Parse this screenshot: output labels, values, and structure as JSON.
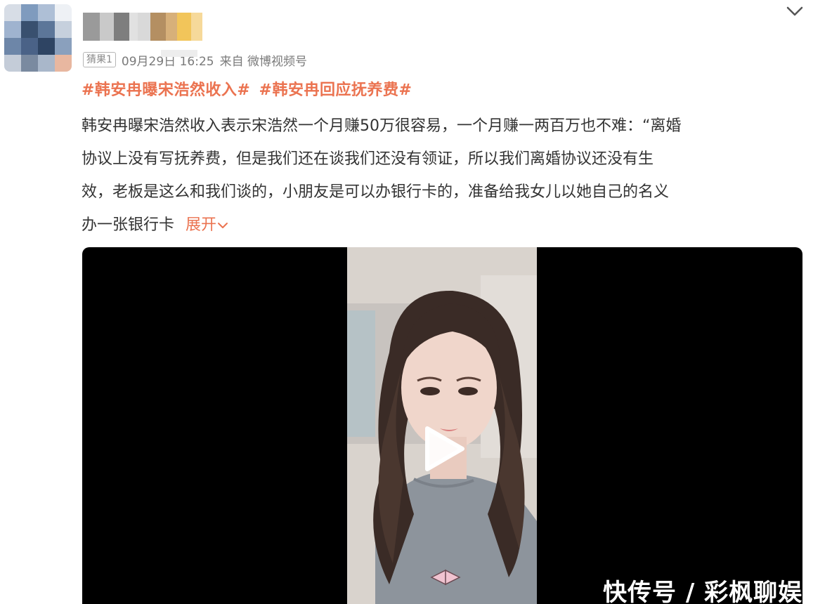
{
  "header": {
    "badge": "猜果1",
    "timestamp": "09月29日 16:25",
    "source": "来自 微博视频号",
    "menu_icon": "chevron-down-icon"
  },
  "post": {
    "tags": [
      "#韩安冉曝宋浩然收入#",
      "#韩安冉回应抚养费#"
    ],
    "lines": [
      "韩安冉曝宋浩然收入表示宋浩然一个月赚50万很容易，一个月赚一两百万也不难：“离婚",
      "协议上没有写抚养费，但是我们还在谈我们还没有领证，所以我们离婚协议还没有生",
      "效，老板是这么和我们谈的，小朋友是可以办银行卡的，准备给我女儿以她自己的名义",
      "办一张银行卡"
    ],
    "expand_label": "展开",
    "accent_color": "#eb7350"
  },
  "video": {
    "play_icon": "play-icon",
    "watermark": "快传号 / 彩枫聊娱"
  }
}
